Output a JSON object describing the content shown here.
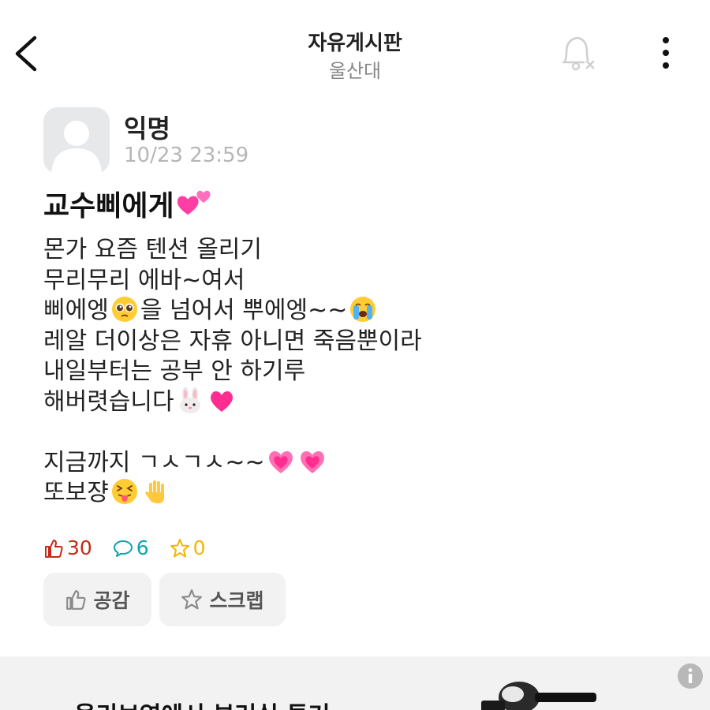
{
  "header": {
    "title": "자유게시판",
    "subtitle": "울산대",
    "icons": {
      "back": "chevron-left-icon",
      "bell": "bell-off-icon",
      "more": "more-vertical-icon"
    }
  },
  "post": {
    "author": "익명",
    "date": "10/23 23:59",
    "title": "교수삐에게",
    "body": {
      "line1": "몬가 요즘 텐션 올리기",
      "line2": "무리무리 에바~여서",
      "line3a": "삐에엥",
      "line3b": "을 넘어서 뿌에엥~~",
      "line4": "레알 더이상은 자휴 아니면 죽음뿐이라",
      "line5": "내일부터는 공부 안 하기루",
      "line6": "해버렷습니다",
      "line7": "지금까지 ㄱㅅㄱㅅ~~",
      "line8": "또보쟝"
    }
  },
  "stats": {
    "likes": "30",
    "comments": "6",
    "scraps": "0"
  },
  "actions": {
    "like_label": "공감",
    "scrap_label": "스크랩"
  },
  "ad": {
    "text": "올리브영에서 부러실 투거"
  },
  "colors": {
    "like": "#c62917",
    "comment": "#0ca5af",
    "scrap": "#f2b600",
    "heart": "#ff2d8f",
    "muted": "#b6b6b6"
  }
}
